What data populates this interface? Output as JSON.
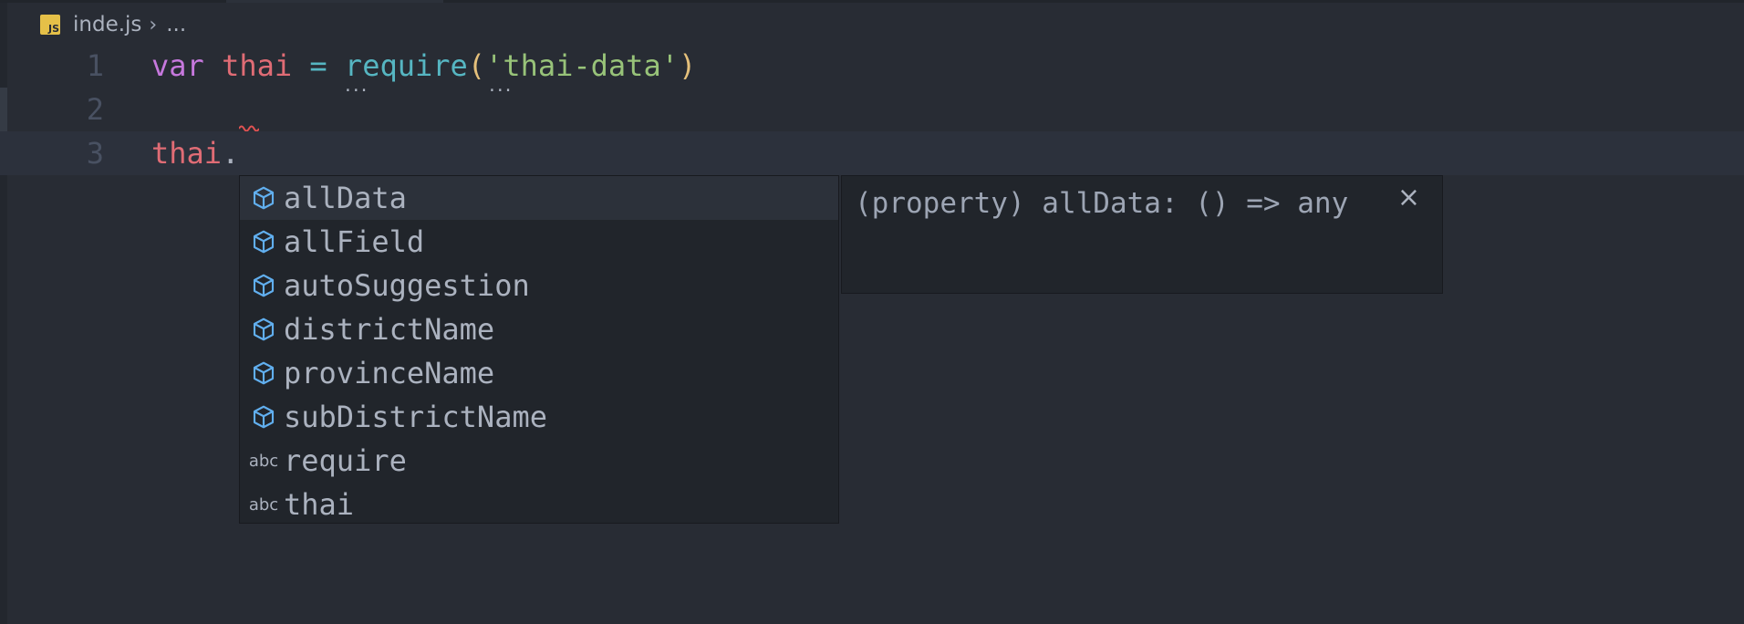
{
  "breadcrumb": {
    "file_icon_label": "JS",
    "filename": "inde.js",
    "separator": "›",
    "more": "..."
  },
  "editor": {
    "lines": [
      {
        "number": "1",
        "tokens": [
          "var",
          " ",
          "thai",
          " ",
          "=",
          " ",
          "require",
          "(",
          "'thai-data'",
          ")"
        ]
      },
      {
        "number": "2",
        "tokens": []
      },
      {
        "number": "3",
        "tokens": [
          "thai",
          "."
        ]
      }
    ],
    "hint_dots": "..."
  },
  "suggest": {
    "items": [
      {
        "label": "allData",
        "kind": "property",
        "icon": "cube-icon",
        "selected": true
      },
      {
        "label": "allField",
        "kind": "property",
        "icon": "cube-icon"
      },
      {
        "label": "autoSuggestion",
        "kind": "property",
        "icon": "cube-icon"
      },
      {
        "label": "districtName",
        "kind": "property",
        "icon": "cube-icon"
      },
      {
        "label": "provinceName",
        "kind": "property",
        "icon": "cube-icon"
      },
      {
        "label": "subDistrictName",
        "kind": "property",
        "icon": "cube-icon"
      },
      {
        "label": "require",
        "kind": "text",
        "icon": "abc"
      },
      {
        "label": "thai",
        "kind": "text",
        "icon": "abc"
      }
    ]
  },
  "details": {
    "signature": "(property) allData: () => any",
    "close_glyph": "×"
  },
  "colors": {
    "background": "#282c34",
    "keyword": "#c678dd",
    "variable": "#e06c75",
    "string": "#98c379",
    "property_icon": "#61afef",
    "current_line": "#2c313c"
  }
}
